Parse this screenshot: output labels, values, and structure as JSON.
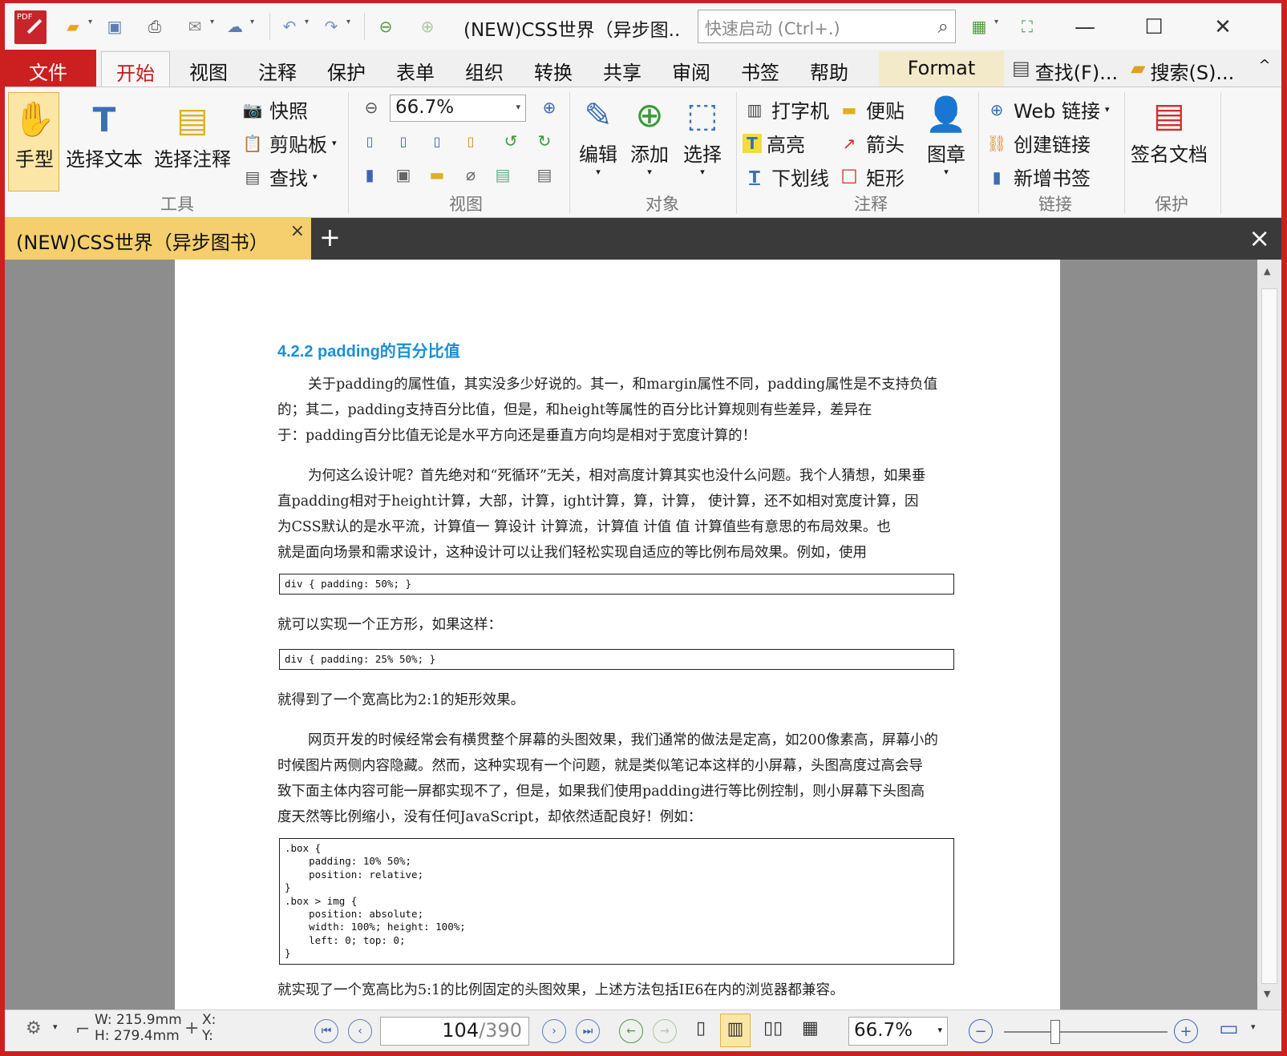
{
  "app": {
    "logo_text": "PDF",
    "window_title": "(NEW)CSS世界（异步图..",
    "quick_launch_placeholder": "快速启动 (Ctrl+.)"
  },
  "menu": {
    "file": "文件",
    "tabs": [
      "开始",
      "视图",
      "注释",
      "保护",
      "表单",
      "组织",
      "转换",
      "共享",
      "审阅",
      "书签",
      "帮助"
    ],
    "format": "Format",
    "find": "查找(F)...",
    "search": "搜索(S)...",
    "collapse": "^"
  },
  "ribbon": {
    "tools": {
      "hand": "手型",
      "select_text": "选择文本",
      "select_annot": "选择注释",
      "snapshot": "快照",
      "clipboard": "剪贴板",
      "find": "查找",
      "group": "工具"
    },
    "view": {
      "zoom": "66.7%",
      "group": "视图"
    },
    "objects": {
      "edit": "编辑",
      "add": "添加",
      "select": "选择",
      "group": "对象"
    },
    "annotations": {
      "typewriter": "打字机",
      "note": "便贴",
      "highlight": "高亮",
      "arrow": "箭头",
      "underline": "下划线",
      "rect": "矩形",
      "stamp": "图章",
      "group": "注释"
    },
    "links": {
      "web": "Web 链接",
      "create": "创建链接",
      "bookmark": "新增书签",
      "group": "链接"
    },
    "protect": {
      "sign": "签名文档",
      "group": "保护"
    }
  },
  "doc_tab": {
    "title": "(NEW)CSS世界（异步图书）",
    "close": "×",
    "add": "+",
    "close_all": "×"
  },
  "page": {
    "heading": "4.2.2   padding的百分比值",
    "p1": [
      "关于padding的属性值，其实没多少好说的。其一，和margin属性不同，padding属性是不支持负值",
      "的；其二，padding支持百分比值，但是，和height等属性的百分比计算规则有些差异，差异在",
      "于：padding百分比值无论是水平方向还是垂直方向均是相对于宽度计算的！"
    ],
    "p2": [
      "为何这么设计呢？首先绝对和“死循环”无关，相对高度计算其实也没什么问题。我个人猜想，如果垂",
      "直padding相对于height计算，大部，计算，ight计算，算，计算，  使计算，还不如相对宽度计算，因",
      "为CSS默认的是水平流，计算值一 算设计  计算流，计算值  计值      值   计算值些有意思的布局效果。也",
      "就是面向场景和需求设计，这种设计可以让我们轻松实现自适应的等比例布局效果。例如，使用"
    ],
    "code1": "div { padding: 50%; }",
    "p3": "就可以实现一个正方形，如果这样：",
    "code2": "div { padding: 25% 50%; }",
    "p4": "就得到了一个宽高比为2:1的矩形效果。",
    "p5": [
      "网页开发的时候经常会有横贯整个屏幕的头图效果，我们通常的做法是定高，如200像素高，屏幕小的",
      "时候图片两侧内容隐藏。然而，这种实现有一个问题，就是类似笔记本这样的小屏幕，头图高度过高会导",
      "致下面主体内容可能一屏都实现不了，但是，如果我们使用padding进行等比例控制，则小屏幕下头图高",
      "度天然等比例缩小，没有任何JavaScript，却依然适配良好！例如："
    ],
    "code3": ".box {\n    padding: 10% 50%;\n    position: relative;\n}\n.box > img {\n    position: absolute;\n    width: 100%; height: 100%;\n    left: 0; top: 0;\n}",
    "p6": "就实现了一个宽高比为5:1的比例固定的头图效果，上述方法包括IE6在内的浏览器都兼容。"
  },
  "status": {
    "width": "W: 215.9mm",
    "height": "H: 279.4mm",
    "x": "X:",
    "y": "Y:",
    "page_current": "104",
    "page_total": "/390",
    "zoom": "66.7%"
  }
}
